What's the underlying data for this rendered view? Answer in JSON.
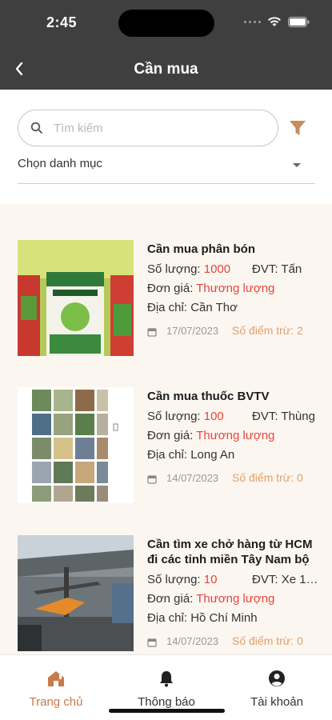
{
  "status_bar": {
    "time": "2:45"
  },
  "header": {
    "title": "Cần mua"
  },
  "search": {
    "placeholder": "Tìm kiếm"
  },
  "category": {
    "label": "Chọn danh mục"
  },
  "listings": [
    {
      "title": "Cần mua phân bón",
      "qty_label": "Số lượng: ",
      "qty": "1000",
      "unit_label": "ĐVT: ",
      "unit": "Tấn",
      "price_label": "Đơn giá: ",
      "price": "Thương lượng",
      "address_label": "Địa chỉ: ",
      "address": "Cần Thơ",
      "date": "17/07/2023",
      "score": "Số điểm trừ: 2"
    },
    {
      "title": "Cần mua thuốc BVTV",
      "qty_label": "Số lượng: ",
      "qty": "100",
      "unit_label": "ĐVT: ",
      "unit": "Thùng",
      "price_label": "Đơn giá: ",
      "price": "Thương lượng",
      "address_label": "Địa chỉ: ",
      "address": "Long An",
      "date": "14/07/2023",
      "score": "Số điểm trừ: 0"
    },
    {
      "title": "Cần tìm xe chở hàng từ HCM đi các tỉnh miền Tây Nam bộ",
      "qty_label": "Số lượng: ",
      "qty": "10",
      "unit_label": "ĐVT: ",
      "unit": "Xe 1…",
      "price_label": "Đơn giá: ",
      "price": "Thương lượng",
      "address_label": "Địa chỉ: ",
      "address": "Hồ Chí Minh",
      "date": "14/07/2023",
      "score": "Số điểm trừ: 0"
    }
  ],
  "tabs": [
    {
      "label": "Trang chủ",
      "icon": "home-icon",
      "active": true
    },
    {
      "label": "Thông báo",
      "icon": "bell-icon",
      "active": false
    },
    {
      "label": "Tài khoản",
      "icon": "account-icon",
      "active": false
    }
  ],
  "colors": {
    "bar": "#3f3f3f",
    "accent": "#c87a4a",
    "price_red": "#e8453c",
    "list_bg": "#fcf6f1",
    "score": "#e2a06a"
  }
}
